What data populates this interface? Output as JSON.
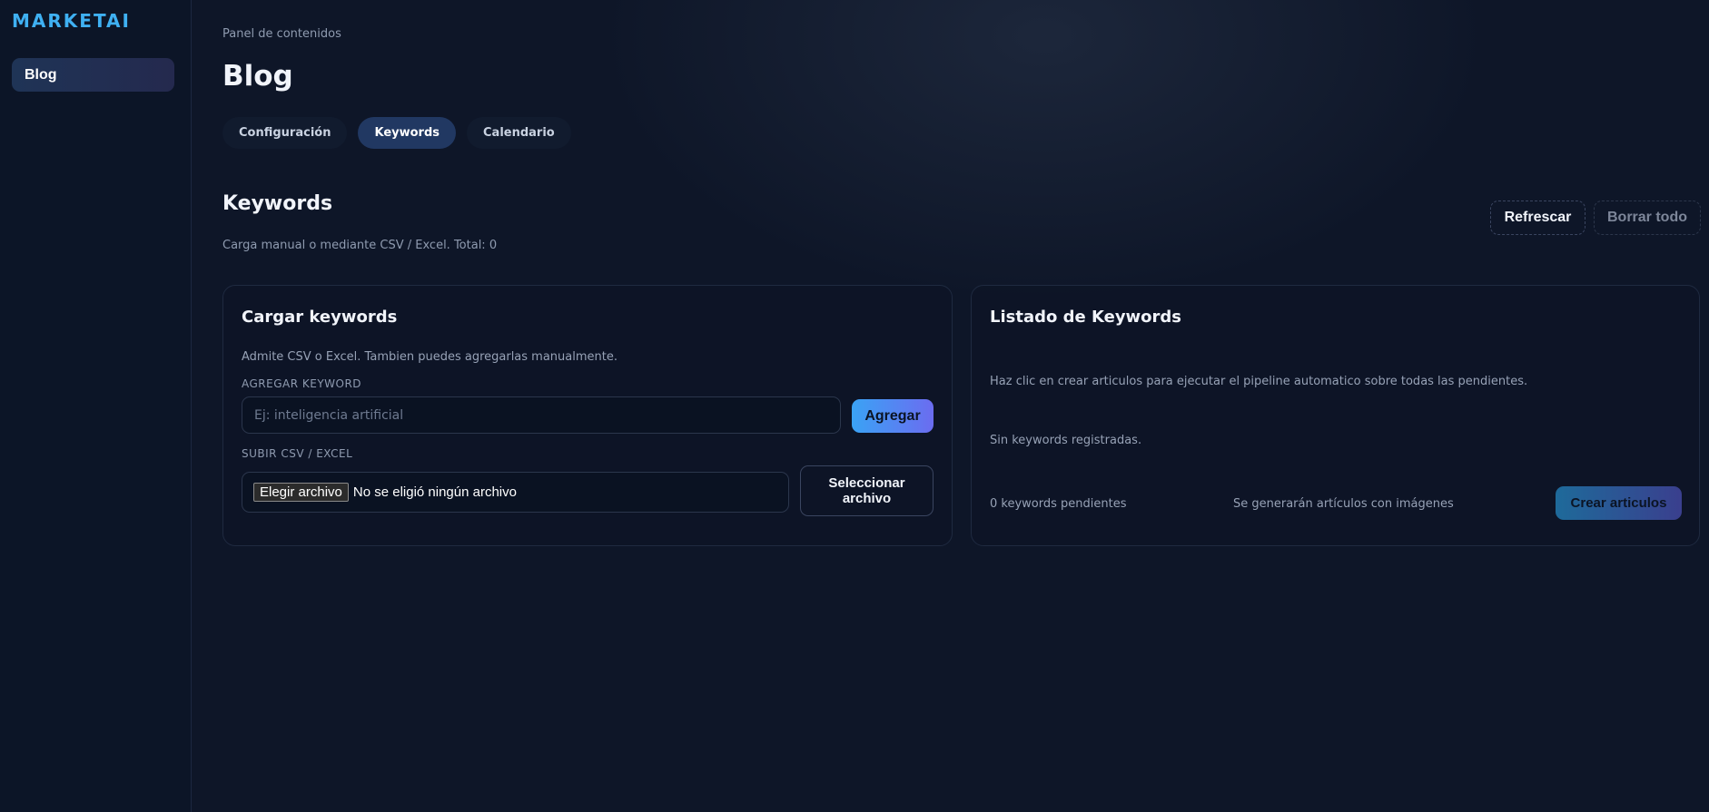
{
  "app": {
    "brand": "MARKETAI"
  },
  "sidebar": {
    "items": [
      {
        "label": "Blog"
      }
    ]
  },
  "header": {
    "breadcrumb": "Panel de contenidos",
    "title": "Blog",
    "tabs": [
      {
        "label": "Configuración",
        "active": false
      },
      {
        "label": "Keywords",
        "active": true
      },
      {
        "label": "Calendario",
        "active": false
      }
    ]
  },
  "section": {
    "title": "Keywords",
    "subtitle": "Carga manual o mediante CSV / Excel. Total: 0",
    "refresh_label": "Refrescar",
    "clear_label": "Borrar todo"
  },
  "upload_card": {
    "title": "Cargar keywords",
    "description": "Admite CSV o Excel. Tambien puedes agregarlas manualmente.",
    "add_label": "AGREGAR KEYWORD",
    "input_value": "",
    "input_placeholder": "Ej: inteligencia artificial",
    "add_button": "Agregar",
    "upload_label": "SUBIR CSV / EXCEL",
    "file_button": "Elegir archivo",
    "file_status": "No se eligió ningún archivo",
    "select_button": "Seleccionar archivo"
  },
  "list_card": {
    "title": "Listado de Keywords",
    "hint": "Haz clic en crear articulos para ejecutar el pipeline automatico sobre todas las pendientes.",
    "empty": "Sin keywords registradas.",
    "pending": "0 keywords pendientes",
    "images_note": "Se generarán artículos con imágenes",
    "create_button": "Crear articulos"
  },
  "colors": {
    "accent": "#3fb0f2",
    "background": "#0e1628",
    "active_tab": "#213862"
  }
}
